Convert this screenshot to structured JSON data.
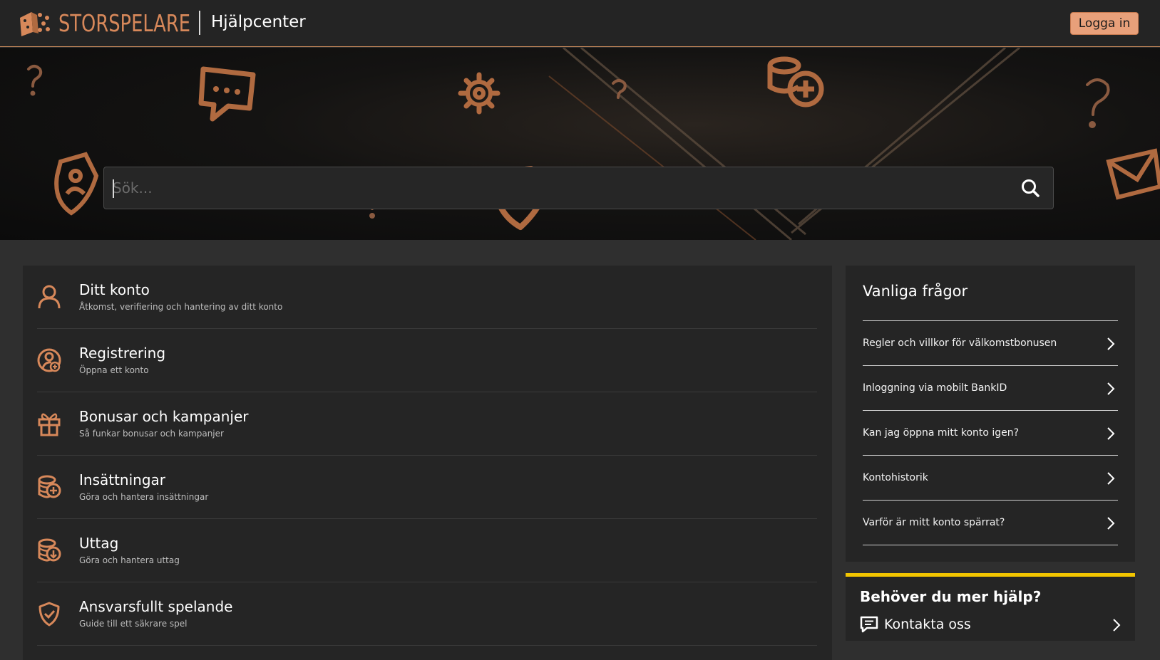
{
  "header": {
    "logo_text": "STORSPELARE",
    "title": "Hjälpcenter",
    "login_label": "Logga in"
  },
  "search": {
    "placeholder": "Sök..."
  },
  "categories": [
    {
      "title": "Ditt konto",
      "subtitle": "Åtkomst, verifiering och hantering av ditt konto",
      "icon": "user-icon"
    },
    {
      "title": "Registrering",
      "subtitle": "Öppna ett konto",
      "icon": "user-add-icon"
    },
    {
      "title": "Bonusar och kampanjer",
      "subtitle": "Så funkar bonusar och kampanjer",
      "icon": "gift-icon"
    },
    {
      "title": "Insättningar",
      "subtitle": "Göra och hantera insättningar",
      "icon": "coins-plus-icon"
    },
    {
      "title": "Uttag",
      "subtitle": "Göra och hantera uttag",
      "icon": "coins-down-icon"
    },
    {
      "title": "Ansvarsfullt spelande",
      "subtitle": "Guide till ett säkrare spel",
      "icon": "shield-check-icon"
    }
  ],
  "faq": {
    "title": "Vanliga frågor",
    "items": [
      {
        "label": "Regler och villkor för välkomstbonusen"
      },
      {
        "label": "Inloggning via mobilt BankID"
      },
      {
        "label": "Kan jag öppna mitt konto igen?"
      },
      {
        "label": "Kontohistorik"
      },
      {
        "label": "Varför är mitt konto spärrat?"
      }
    ]
  },
  "help": {
    "title": "Behöver du mer hjälp?",
    "contact_label": "Kontakta oss"
  },
  "colors": {
    "accent": "#e8a07a",
    "icon": "#d7885a",
    "help_border": "#f2c500",
    "panel": "#252525",
    "background": "#2f2f2f"
  }
}
